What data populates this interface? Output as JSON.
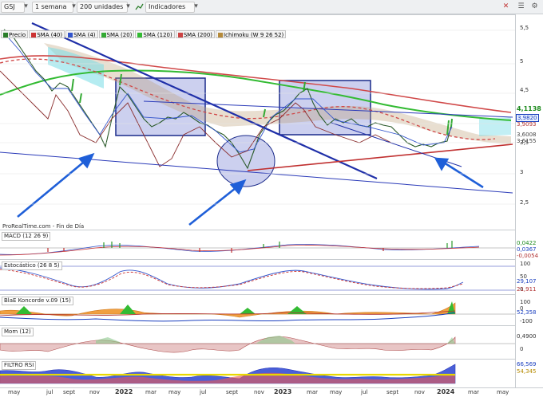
{
  "toolbar": {
    "symbol": "GSJ",
    "timeframe": "1 semana",
    "units": "200 unidades",
    "indicators_label": "Indicadores"
  },
  "legend": {
    "items": [
      {
        "label": "Precio",
        "color": "#2a7d2a"
      },
      {
        "label": "SMA (40)",
        "color": "#cc3333"
      },
      {
        "label": "SMA (4)",
        "color": "#3355cc"
      },
      {
        "label": "SMA (20)",
        "color": "#33aa33"
      },
      {
        "label": "SMA (120)",
        "color": "#33bb33"
      },
      {
        "label": "SMA (200)",
        "color": "#cc4444"
      },
      {
        "label": "Ichimoku (W 9 26 52)",
        "color": "#b58a3a"
      }
    ]
  },
  "price_axis": {
    "ticks": [
      "5,5",
      "5",
      "4,5",
      "4",
      "3,5",
      "3",
      "2,5"
    ]
  },
  "price_badges": [
    {
      "text": "4,1138",
      "color": "#1c8a1c",
      "bg": "#ffffff"
    },
    {
      "text": "3,9820",
      "color": "#1a3fbf",
      "bg": "#ffffff"
    },
    {
      "text": "3,9093",
      "color": "#b03030",
      "bg": "#ffffff"
    },
    {
      "text": "3,6008",
      "color": "#444444",
      "bg": "#ffffff"
    },
    {
      "text": "3,6155",
      "color": "#444444",
      "bg": "#ffffff"
    }
  ],
  "credit": "ProRealTime.com - Fin de Día",
  "panels": {
    "macd": {
      "label": "MACD (12 26 9)",
      "ticks": [],
      "values": [
        {
          "text": "0,0422",
          "color": "#1c8a1c"
        },
        {
          "text": "0,0367",
          "color": "#1a3fbf"
        },
        {
          "text": "-0,0054",
          "color": "#b03030"
        }
      ]
    },
    "estocastico": {
      "label": "Estocástico (26 8 5)",
      "ticks": [
        "100",
        "50",
        "0"
      ],
      "values": [
        {
          "text": "29,107",
          "color": "#1a3fbf"
        },
        {
          "text": "21,911",
          "color": "#b03030"
        }
      ]
    },
    "blae": {
      "label": "BlaE Koncorde v.09 (15)",
      "ticks": [
        "100",
        "0",
        "-100"
      ],
      "values": [
        {
          "text": "52,358",
          "color": "#1a3fbf"
        }
      ]
    },
    "mom": {
      "label": "Mom (12)",
      "ticks": [
        "0"
      ],
      "values": [
        {
          "text": "0,4900",
          "color": "#333333"
        }
      ]
    },
    "rsi": {
      "label": "FILTRO RSI",
      "ticks": [],
      "values": [
        {
          "text": "66,569",
          "color": "#1a3fbf"
        },
        {
          "text": "54,345",
          "color": "#b58a00"
        }
      ]
    }
  },
  "x_axis": {
    "labels": [
      {
        "text": "may",
        "bold": false
      },
      {
        "text": "jul",
        "bold": false
      },
      {
        "text": "sept",
        "bold": false
      },
      {
        "text": "nov",
        "bold": false
      },
      {
        "text": "2022",
        "bold": true
      },
      {
        "text": "mar",
        "bold": false
      },
      {
        "text": "may",
        "bold": false
      },
      {
        "text": "jul",
        "bold": false
      },
      {
        "text": "sept",
        "bold": false
      },
      {
        "text": "nov",
        "bold": false
      },
      {
        "text": "2023",
        "bold": true
      },
      {
        "text": "mar",
        "bold": false
      },
      {
        "text": "may",
        "bold": false
      },
      {
        "text": "jul",
        "bold": false
      },
      {
        "text": "sept",
        "bold": false
      },
      {
        "text": "nov",
        "bold": false
      },
      {
        "text": "2024",
        "bold": true
      },
      {
        "text": "mar",
        "bold": false
      },
      {
        "text": "may",
        "bold": false
      }
    ]
  }
}
